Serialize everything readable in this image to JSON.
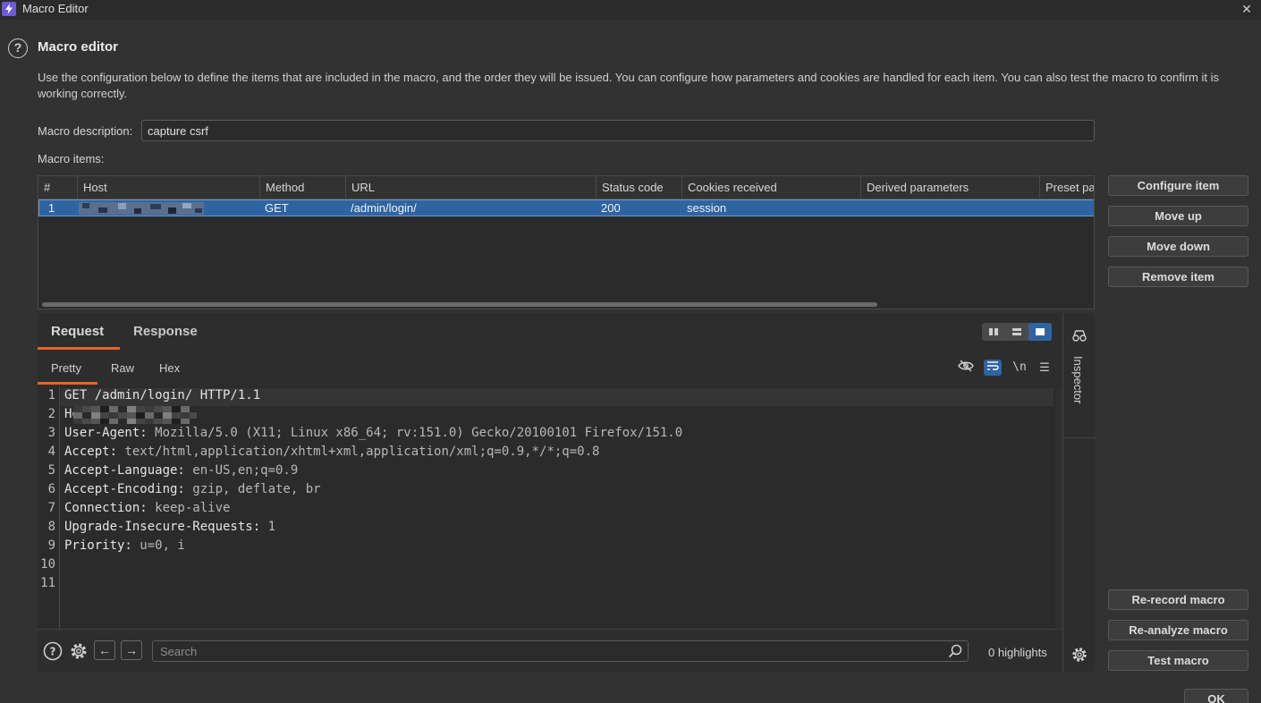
{
  "window": {
    "title": "Macro Editor"
  },
  "header": {
    "title": "Macro editor",
    "description": "Use the configuration below to define the items that are included in the macro, and the order they will be issued. You can configure how parameters and cookies are handled for each item. You can also test the macro to confirm it is working correctly."
  },
  "macro_description": {
    "label": "Macro description:",
    "value": "capture csrf"
  },
  "macro_items": {
    "label": "Macro items:",
    "columns": [
      "#",
      "Host",
      "Method",
      "URL",
      "Status code",
      "Cookies received",
      "Derived parameters",
      "Preset pa"
    ],
    "rows": [
      {
        "num": "1",
        "host": "",
        "method": "GET",
        "url": "/admin/login/",
        "status": "200",
        "cookies": "session",
        "derived": "",
        "preset": ""
      }
    ]
  },
  "item_buttons": [
    "Configure item",
    "Move up",
    "Move down",
    "Remove item"
  ],
  "macro_buttons": [
    "Re-record macro",
    "Re-analyze macro",
    "Test macro"
  ],
  "ok_button": "OK",
  "editor": {
    "tabs": [
      "Request",
      "Response"
    ],
    "subtabs": [
      "Pretty",
      "Raw",
      "Hex"
    ],
    "line_numbers": [
      "1",
      "2",
      "3",
      "4",
      "5",
      "6",
      "7",
      "8",
      "9",
      "10",
      "11"
    ],
    "lines": [
      {
        "key": "GET /admin/login/ HTTP/1.1",
        "val": ""
      },
      {
        "key": "Host",
        "val": ""
      },
      {
        "key": "User-Agent:",
        "val": " Mozilla/5.0 (X11; Linux x86_64; rv:151.0) Gecko/20100101 Firefox/151.0"
      },
      {
        "key": "Accept:",
        "val": " text/html,application/xhtml+xml,application/xml;q=0.9,*/*;q=0.8"
      },
      {
        "key": "Accept-Language:",
        "val": " en-US,en;q=0.9"
      },
      {
        "key": "Accept-Encoding:",
        "val": " gzip, deflate, br"
      },
      {
        "key": "Connection:",
        "val": " keep-alive"
      },
      {
        "key": "Upgrade-Insecure-Requests:",
        "val": " 1"
      },
      {
        "key": "Priority:",
        "val": " u=0, i"
      }
    ],
    "search_placeholder": "Search",
    "highlights": "0 highlights"
  },
  "inspector": {
    "label": "Inspector"
  },
  "colors": {
    "accent": "#e3642c",
    "selection": "#2f64a0",
    "background": "#323232"
  }
}
